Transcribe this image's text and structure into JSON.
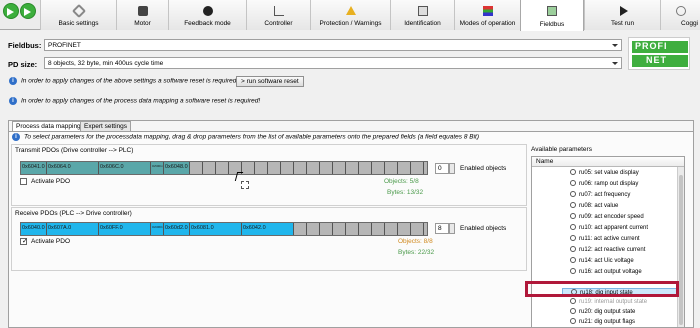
{
  "tabs": [
    {
      "label": "Basic settings",
      "icon": "wrench-icon"
    },
    {
      "label": "Motor",
      "icon": "motor-icon"
    },
    {
      "label": "Feedback mode",
      "icon": "feedback-icon"
    },
    {
      "label": "Controller",
      "icon": "chart-icon"
    },
    {
      "label": "Protection / Warnings",
      "icon": "warning-icon"
    },
    {
      "label": "Identification",
      "icon": "identification-icon"
    },
    {
      "label": "Modes of operation",
      "icon": "modes-icon"
    },
    {
      "label": "Fieldbus",
      "icon": "fieldbus-icon"
    },
    {
      "label": "Test run",
      "icon": "play-icon"
    },
    {
      "label": "Coggi",
      "icon": "cogging-icon"
    }
  ],
  "fieldbus": {
    "label": "Fieldbus:",
    "value": "PROFINET",
    "logo_text": "PROFI NET"
  },
  "pd_size": {
    "label": "PD size:",
    "value": "8 objects, 32 byte, min 400us cycle time"
  },
  "info": {
    "reset_note_1": "In order to apply changes of the above settings a software reset is required!",
    "reset_button": "> run software reset",
    "reset_note_2": "In order to apply changes of the process data mapping a software reset is required!"
  },
  "subtabs": [
    "Process data mapping",
    "Expert settings"
  ],
  "hint": "To select parameters for the processdata mapping, drag & drop parameters from the list of available parameters onto the prepared fields (a field equates 8 Bit)",
  "transmit": {
    "title": "Transmit PDOs (Drive controller --> PLC)",
    "cells": [
      "0x6041.0",
      "0x6064.0",
      "0x606C.0",
      "0x5001.0",
      "0x6048.0"
    ],
    "activate_label": "Activate PDO",
    "enabled_label": "Enabled objects",
    "enabled_value": "0",
    "objects": "Objects: 5/8",
    "bytes": "Bytes: 13/32"
  },
  "receive": {
    "title": "Receive PDOs (PLC --> Drive controller)",
    "cells": [
      "0x6040.0",
      "0x607A.0",
      "0x60FF.0",
      "0x6060.0",
      "0x60d2.0",
      "0x6081.0",
      "0x6042.0"
    ],
    "activate_label": "Activate PDO",
    "enabled_label": "Enabled objects",
    "enabled_value": "8",
    "objects": "Objects: 8/8",
    "bytes": "Bytes: 22/32"
  },
  "available": {
    "title": "Available parameters",
    "column": "Name",
    "items": [
      "ru05: set value display",
      "ru06: ramp out display",
      "ru07: act frequency",
      "ru08: act value",
      "ru09: act encoder speed",
      "ru10: act apparent current",
      "ru11: act active current",
      "ru12: act reactive current",
      "ru14: act Uic voltage",
      "ru16: act output voltage"
    ],
    "highlighted": "ru18: dig input state",
    "items_after": [
      "ru19: internal output state",
      "ru20: dig output state",
      "ru21: dig output flags"
    ]
  },
  "colors": {
    "transmit_fill": "#5aa7a9",
    "receive_fill": "#20b6ec",
    "highlight": "#b0183a",
    "green_text": "#4a9a4a",
    "orange_text": "#d08a20"
  }
}
